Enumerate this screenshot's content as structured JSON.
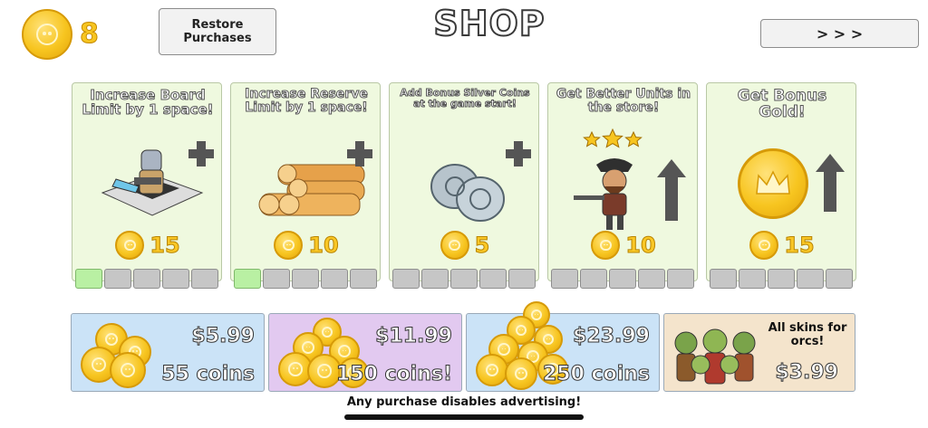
{
  "header": {
    "coin_balance": "8",
    "restore_label": "Restore\nPurchases",
    "title": "SHOP",
    "next_label": "> > >"
  },
  "upgrades": [
    {
      "title": "Increase Board Limit by 1 space!",
      "price": "15",
      "icon": "knight-on-board",
      "indicator": "plus-icon",
      "levels_filled": 1,
      "levels_total": 5
    },
    {
      "title": "Increase Reserve Limit by 1 space!",
      "price": "10",
      "icon": "wood-logs",
      "indicator": "plus-icon",
      "levels_filled": 1,
      "levels_total": 5
    },
    {
      "title": "Add Bonus Silver Coins at the game start!",
      "price": "5",
      "icon": "silver-coins",
      "indicator": "plus-icon",
      "levels_filled": 0,
      "levels_total": 5
    },
    {
      "title": "Get Better Units in the store!",
      "price": "10",
      "icon": "pirate-unit-three-stars",
      "indicator": "up-arrow-icon",
      "levels_filled": 0,
      "levels_total": 5
    },
    {
      "title": "Get Bonus Gold!",
      "price": "15",
      "icon": "gold-crown-coin",
      "indicator": "up-arrow-icon",
      "levels_filled": 0,
      "levels_total": 5
    }
  ],
  "bundles": [
    {
      "price": "$5.99",
      "coins": "55 coins",
      "bg": "#cbe3f7"
    },
    {
      "price": "$11.99",
      "coins": "150 coins!",
      "bg": "#e2c9f0"
    },
    {
      "price": "$23.99",
      "coins": "250 coins",
      "bg": "#cbe3f7"
    },
    {
      "title": "All skins for orcs!",
      "price": "$3.99",
      "bg": "#f4e4cc"
    }
  ],
  "footer": {
    "note": "Any purchase disables advertising!"
  },
  "colors": {
    "gold": "#f7c520",
    "card_bg": "#eff9df",
    "level_on": "#b9f0a3",
    "level_off": "#c6c6c6"
  }
}
